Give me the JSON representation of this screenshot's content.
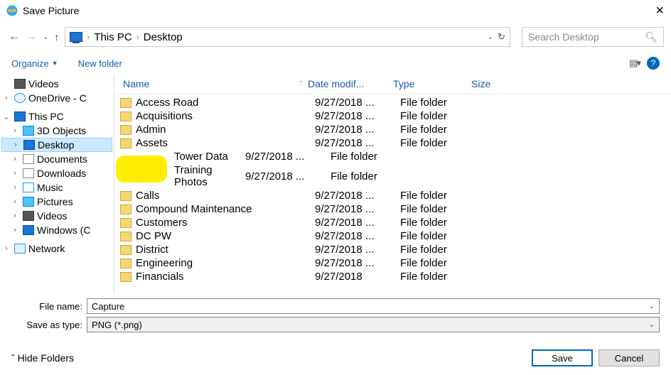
{
  "window": {
    "title": "Save Picture"
  },
  "nav": {
    "breadcrumbs": [
      "This PC",
      "Desktop"
    ],
    "search_placeholder": "Search Desktop"
  },
  "toolbar": {
    "organize": "Organize",
    "new_folder": "New folder"
  },
  "tree": {
    "videos": "Videos",
    "onedrive": "OneDrive - C",
    "thispc": "This PC",
    "objects3d": "3D Objects",
    "desktop": "Desktop",
    "documents": "Documents",
    "downloads": "Downloads",
    "music": "Music",
    "pictures": "Pictures",
    "videos2": "Videos",
    "windows": "Windows (C",
    "network": "Network"
  },
  "columns": {
    "name": "Name",
    "date": "Date modif...",
    "type": "Type",
    "size": "Size"
  },
  "files": [
    {
      "name": "Access Road",
      "date": "9/27/2018 ...",
      "type": "File folder"
    },
    {
      "name": "Acquisitions",
      "date": "9/27/2018 ...",
      "type": "File folder"
    },
    {
      "name": "Admin",
      "date": "9/27/2018 ...",
      "type": "File folder"
    },
    {
      "name": "Assets",
      "date": "9/27/2018 ...",
      "type": "File folder"
    },
    {
      "name": "Tower Data",
      "date": "9/27/2018 ...",
      "type": "File folder"
    },
    {
      "name": "Training Photos",
      "date": "9/27/2018 ...",
      "type": "File folder"
    },
    {
      "name": "Calls",
      "date": "9/27/2018 ...",
      "type": "File folder"
    },
    {
      "name": "Compound Maintenance",
      "date": "9/27/2018 ...",
      "type": "File folder"
    },
    {
      "name": "Customers",
      "date": "9/27/2018 ...",
      "type": "File folder"
    },
    {
      "name": "DC PW",
      "date": "9/27/2018 ...",
      "type": "File folder"
    },
    {
      "name": "District",
      "date": "9/27/2018 ...",
      "type": "File folder"
    },
    {
      "name": "Engineering",
      "date": "9/27/2018 ...",
      "type": "File folder"
    },
    {
      "name": "Financials",
      "date": "9/27/2018",
      "type": "File folder"
    }
  ],
  "filename": {
    "label": "File name:",
    "value": "Capture"
  },
  "savetype": {
    "label": "Save as type:",
    "value": "PNG (*.png)"
  },
  "footer": {
    "hide": "Hide Folders",
    "save": "Save",
    "cancel": "Cancel"
  }
}
